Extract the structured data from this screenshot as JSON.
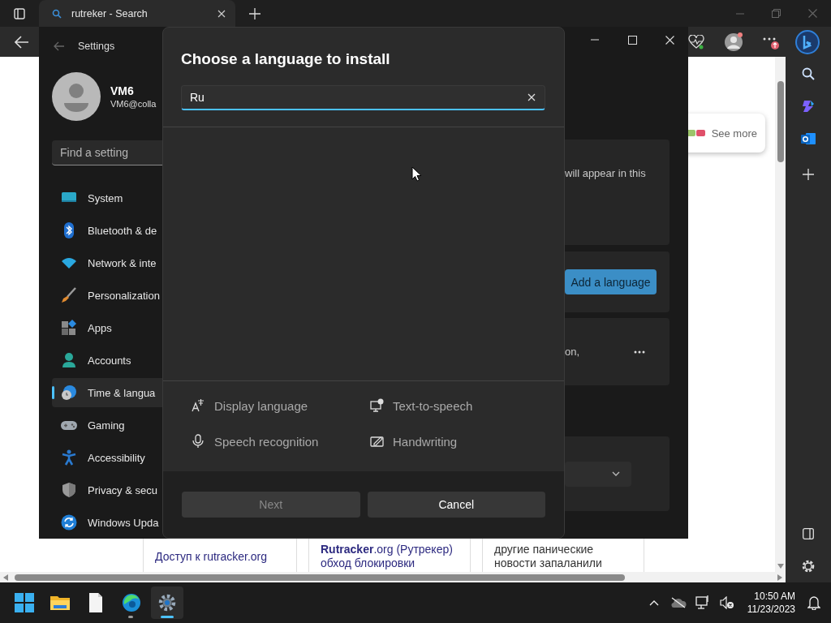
{
  "browser": {
    "tabs": [
      {
        "title": "rutreker - Search",
        "selected": true
      }
    ],
    "suggestion": {
      "link": "See more"
    },
    "results": [
      {
        "lines": [
          "Доступ к rutracker.org"
        ]
      },
      {
        "lines": [
          "**Rutracker**.org (Рутрекер)",
          "обход блокировки"
        ]
      },
      {
        "lines": [
          "другие панические",
          "новости запаланили"
        ]
      }
    ]
  },
  "settings": {
    "window": {
      "title": "Settings"
    },
    "user": {
      "name": "VM6",
      "email": "VM6@colla"
    },
    "search": {
      "placeholder": "Find a setting"
    },
    "nav": [
      {
        "label": "System",
        "selected": false
      },
      {
        "label": "Bluetooth & de",
        "selected": false
      },
      {
        "label": "Network & inte",
        "selected": false
      },
      {
        "label": "Personalization",
        "selected": false
      },
      {
        "label": "Apps",
        "selected": false
      },
      {
        "label": "Accounts",
        "selected": false
      },
      {
        "label": "Time & langua",
        "selected": true
      },
      {
        "label": "Gaming",
        "selected": false
      },
      {
        "label": "Accessibility",
        "selected": false
      },
      {
        "label": "Privacy & secu",
        "selected": false
      },
      {
        "label": "Windows Upda",
        "selected": false
      }
    ],
    "panel": {
      "note": "will appear in this",
      "add_button": "Add a language",
      "fragment": "on,"
    }
  },
  "dialog": {
    "title": "Choose a language to install",
    "search": {
      "value": "Ru"
    },
    "features": [
      {
        "label": "Display language"
      },
      {
        "label": "Text-to-speech"
      },
      {
        "label": "Speech recognition"
      },
      {
        "label": "Handwriting"
      }
    ],
    "buttons": [
      {
        "label": "Next",
        "disabled": true
      },
      {
        "label": "Cancel",
        "disabled": false
      }
    ]
  },
  "taskbar": {
    "apps": [
      {
        "running": false,
        "selected": false
      },
      {
        "running": false,
        "selected": false
      },
      {
        "running": true,
        "selected": false
      },
      {
        "running": true,
        "selected": true
      }
    ],
    "time": "10:50 AM",
    "date": "11/23/2023"
  }
}
